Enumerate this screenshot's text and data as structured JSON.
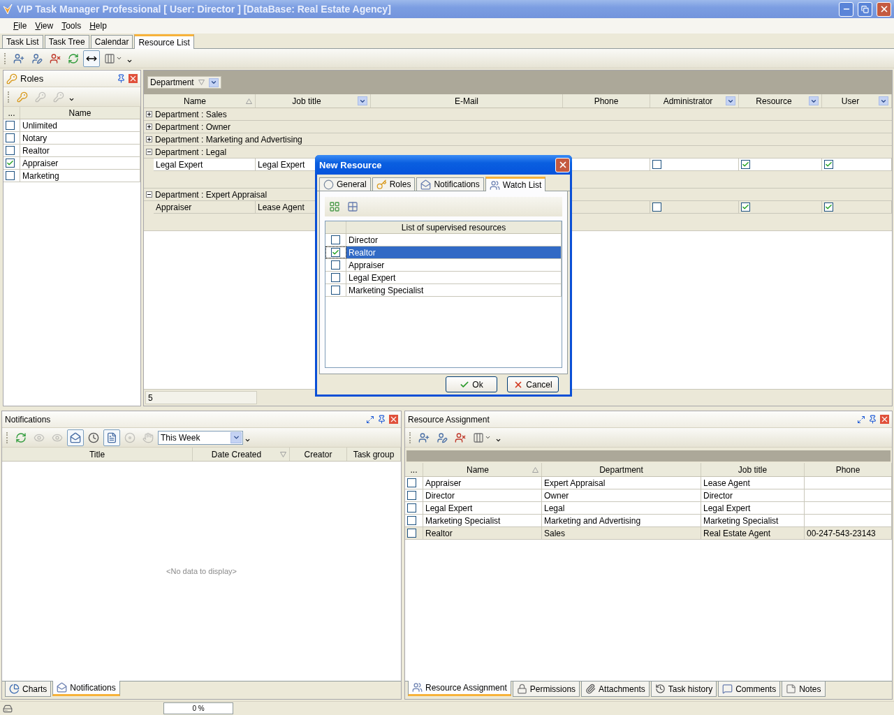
{
  "window": {
    "title": "VIP Task Manager Professional [ User: Director ] [DataBase: Real Estate Agency]"
  },
  "menu": [
    "File",
    "View",
    "Tools",
    "Help"
  ],
  "tabs": [
    {
      "label": "Task List",
      "selected": false
    },
    {
      "label": "Task Tree",
      "selected": false
    },
    {
      "label": "Calendar",
      "selected": false
    },
    {
      "label": "Resource List",
      "selected": true
    }
  ],
  "toolbar": [
    {
      "kind": "add-user",
      "pressed": false,
      "disabled": false
    },
    {
      "kind": "edit-user",
      "pressed": false,
      "disabled": false
    },
    {
      "kind": "delete-user",
      "pressed": false,
      "disabled": false
    },
    {
      "kind": "refresh",
      "pressed": false,
      "disabled": false
    },
    {
      "kind": "fit-columns",
      "pressed": true,
      "disabled": false
    },
    {
      "kind": "columns",
      "pressed": false,
      "disabled": false
    }
  ],
  "roles_panel": {
    "title": "Roles",
    "toolbar": [
      {
        "kind": "add-role",
        "pressed": false,
        "disabled": false
      },
      {
        "kind": "edit-role",
        "pressed": false,
        "disabled": true
      },
      {
        "kind": "delete-role",
        "pressed": false,
        "disabled": true
      }
    ],
    "columns": [
      "...",
      "Name"
    ],
    "rows": [
      {
        "name": "Unlimited",
        "checked": false
      },
      {
        "name": "Notary",
        "checked": false
      },
      {
        "name": "Realtor",
        "checked": false
      },
      {
        "name": "Appraiser",
        "checked": true
      },
      {
        "name": "Marketing",
        "checked": false
      }
    ]
  },
  "resource_grid": {
    "group_by": {
      "label": "Department",
      "sort_ascending": false,
      "sort_descending": true
    },
    "columns": [
      {
        "label": "Name",
        "sort_ascending": true,
        "sort_descending": false,
        "filter_button": false
      },
      {
        "label": "Job title",
        "sort_ascending": false,
        "sort_descending": false,
        "filter_button": true
      },
      {
        "label": "E-Mail",
        "sort_ascending": false,
        "sort_descending": false,
        "filter_button": false
      },
      {
        "label": "Phone",
        "sort_ascending": false,
        "sort_descending": false,
        "filter_button": false
      },
      {
        "label": "Administrator",
        "sort_ascending": false,
        "sort_descending": false,
        "filter_button": true
      },
      {
        "label": "Resource",
        "sort_ascending": false,
        "sort_descending": false,
        "filter_button": true
      },
      {
        "label": "User",
        "sort_ascending": false,
        "sort_descending": false,
        "filter_button": true
      }
    ],
    "groups": [
      {
        "label": "Department : Sales",
        "expanded": false
      },
      {
        "label": "Department : Owner",
        "expanded": false
      },
      {
        "label": "Department : Marketing and Advertising",
        "expanded": false
      },
      {
        "label": "Department : Legal",
        "expanded": true,
        "rows": [
          {
            "name": "Legal Expert",
            "job_title": "Legal Expert",
            "administrator": false,
            "resource": true,
            "user": true,
            "selected": true
          }
        ]
      },
      {
        "label": "Department : Expert Appraisal",
        "expanded": true,
        "rows": [
          {
            "name": "Appraiser",
            "job_title": "Lease Agent",
            "administrator": false,
            "resource": true,
            "user": true,
            "selected": false
          }
        ]
      }
    ],
    "footer_count": "5"
  },
  "dialog": {
    "title": "New Resource",
    "tabs": [
      {
        "kind": "general",
        "label": "General",
        "selected": false
      },
      {
        "kind": "roles",
        "label": "Roles",
        "selected": false
      },
      {
        "kind": "notifications",
        "label": "Notifications",
        "selected": false
      },
      {
        "kind": "watch",
        "label": "Watch List",
        "selected": true
      }
    ],
    "list_header": "List of supervised resources",
    "items": [
      {
        "label": "Director",
        "checked": false,
        "selected": false
      },
      {
        "label": "Realtor",
        "checked": true,
        "selected": true
      },
      {
        "label": "Appraiser",
        "checked": false,
        "selected": false
      },
      {
        "label": "Legal Expert",
        "checked": false,
        "selected": false
      },
      {
        "label": "Marketing Specialist",
        "checked": false,
        "selected": false
      }
    ],
    "buttons": [
      {
        "kind": "ok",
        "label": "Ok"
      },
      {
        "kind": "cancel",
        "label": "Cancel"
      }
    ]
  },
  "notifications": {
    "title": "Notifications",
    "toolbar": [
      {
        "kind": "refresh",
        "pressed": false,
        "disabled": false
      },
      {
        "kind": "eye-mail",
        "pressed": false,
        "disabled": true
      },
      {
        "kind": "eye-mail",
        "pressed": false,
        "disabled": true
      },
      {
        "kind": "open-mail",
        "pressed": true,
        "disabled": false
      },
      {
        "kind": "clock-mail",
        "pressed": false,
        "disabled": false
      },
      {
        "kind": "report",
        "pressed": true,
        "disabled": false
      },
      {
        "kind": "disc",
        "pressed": false,
        "disabled": true
      },
      {
        "kind": "hand",
        "pressed": false,
        "disabled": true
      }
    ],
    "period": "This Week",
    "columns": [
      {
        "label": "Title",
        "sort_ascending": false,
        "sort_descending": false
      },
      {
        "label": "Date Created",
        "sort_ascending": false,
        "sort_descending": true
      },
      {
        "label": "Creator",
        "sort_ascending": false,
        "sort_descending": false
      },
      {
        "label": "Task group",
        "sort_ascending": false,
        "sort_descending": false
      }
    ],
    "empty_text": "<No data to display>",
    "tabs": [
      {
        "kind": "charts",
        "label": "Charts",
        "selected": false
      },
      {
        "kind": "notifications",
        "label": "Notifications",
        "selected": true
      }
    ]
  },
  "resource_assignment": {
    "title": "Resource Assignment",
    "toolbar": [
      {
        "kind": "add-user",
        "pressed": false,
        "disabled": false
      },
      {
        "kind": "edit-user",
        "pressed": false,
        "disabled": false
      },
      {
        "kind": "delete-user",
        "pressed": false,
        "disabled": false
      },
      {
        "kind": "columns",
        "pressed": false,
        "disabled": false
      }
    ],
    "columns": [
      {
        "label": "...",
        "sort_ascending": false,
        "sort_descending": false
      },
      {
        "label": "Name",
        "sort_ascending": true,
        "sort_descending": false
      },
      {
        "label": "Department",
        "sort_ascending": false,
        "sort_descending": false
      },
      {
        "label": "Job title",
        "sort_ascending": false,
        "sort_descending": false
      },
      {
        "label": "Phone",
        "sort_ascending": false,
        "sort_descending": false
      }
    ],
    "rows": [
      {
        "checked": false,
        "name": "Appraiser",
        "department": "Expert Appraisal",
        "job_title": "Lease Agent",
        "phone": "",
        "selected": false
      },
      {
        "checked": false,
        "name": "Director",
        "department": "Owner",
        "job_title": "Director",
        "phone": "",
        "selected": false
      },
      {
        "checked": false,
        "name": "Legal Expert",
        "department": "Legal",
        "job_title": "Legal Expert",
        "phone": "",
        "selected": false
      },
      {
        "checked": false,
        "name": "Marketing Specialist",
        "department": "Marketing and Advertising",
        "job_title": "Marketing Specialist",
        "phone": "",
        "selected": false
      },
      {
        "checked": false,
        "name": "Realtor",
        "department": "Sales",
        "job_title": "Real Estate Agent",
        "phone": "00-247-543-23143",
        "selected": true
      }
    ],
    "tabs": [
      {
        "kind": "assignment",
        "label": "Resource Assignment",
        "selected": true
      },
      {
        "kind": "permissions",
        "label": "Permissions",
        "selected": false
      },
      {
        "kind": "attachments",
        "label": "Attachments",
        "selected": false
      },
      {
        "kind": "history",
        "label": "Task history",
        "selected": false
      },
      {
        "kind": "comments",
        "label": "Comments",
        "selected": false
      },
      {
        "kind": "notes",
        "label": "Notes",
        "selected": false
      }
    ]
  },
  "status_bar": {
    "progress": {
      "level": 0,
      "reading": "0 %"
    }
  }
}
